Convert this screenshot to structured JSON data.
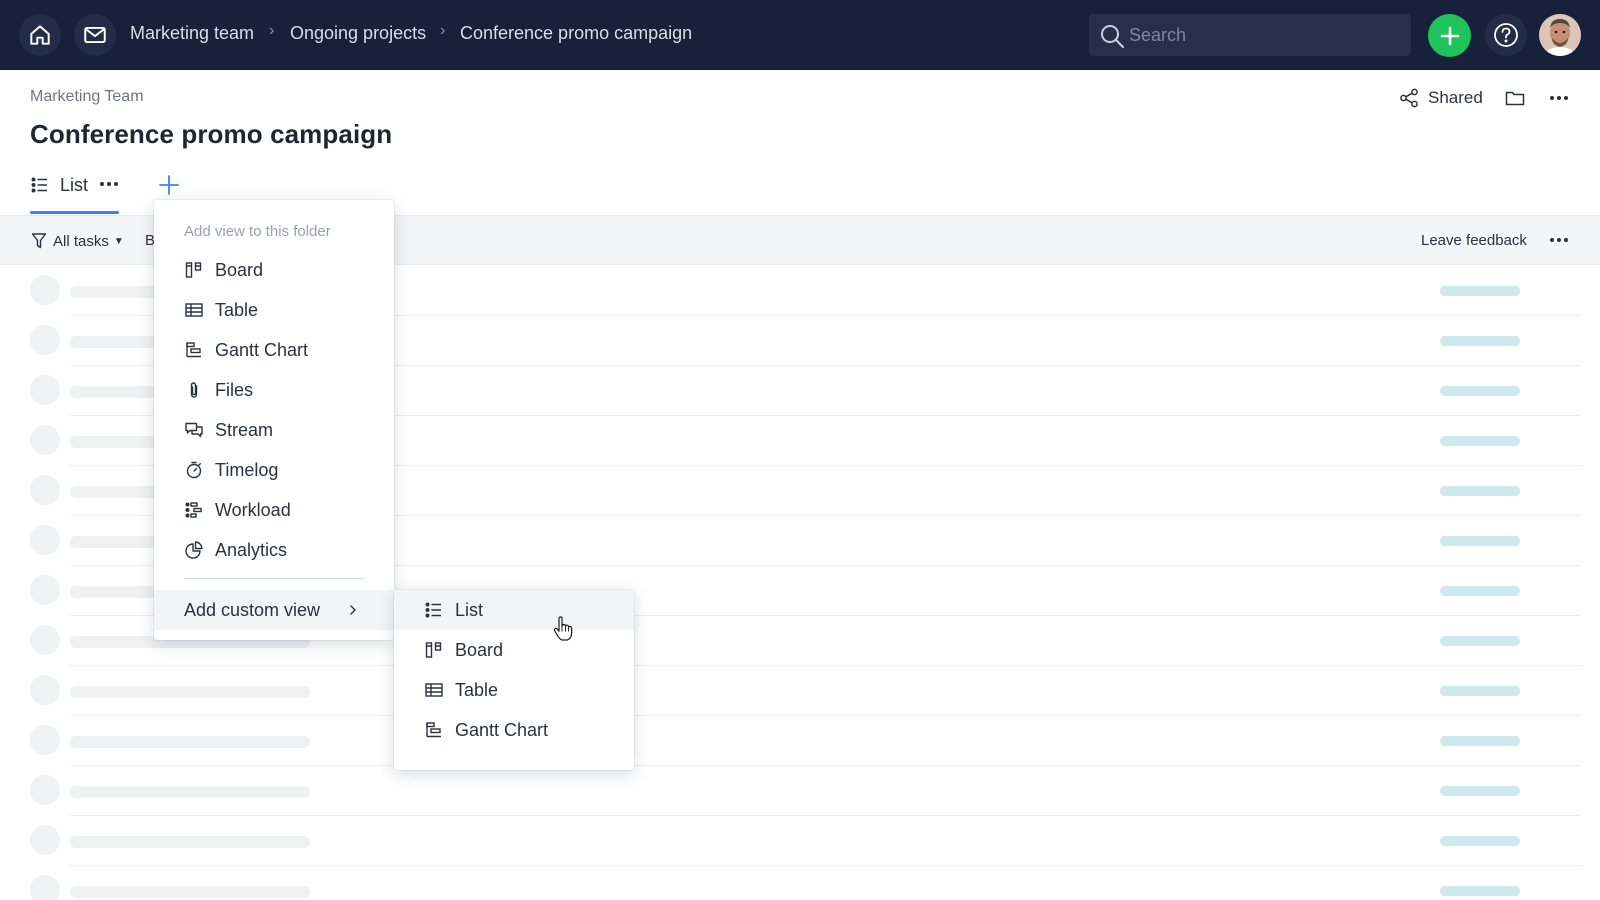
{
  "topbar": {
    "breadcrumbs": [
      "Marketing team",
      "Ongoing projects",
      "Conference promo campaign"
    ],
    "search_placeholder": "Search",
    "icons": [
      "home-icon",
      "mail-icon",
      "search-icon",
      "plus-icon",
      "help-icon",
      "avatar"
    ],
    "accent_color": "#1ec35c",
    "bar_color": "#17213a"
  },
  "header": {
    "folder_name": "Marketing Team",
    "title": "Conference promo campaign",
    "shared_label": "Shared"
  },
  "tabs": {
    "active_label": "List"
  },
  "toolbar": {
    "filter_label": "All tasks",
    "truncated_label": "B",
    "feedback_label": "Leave feedback"
  },
  "add_view_menu": {
    "header": "Add view to this folder",
    "items": [
      "Board",
      "Table",
      "Gantt Chart",
      "Files",
      "Stream",
      "Timelog",
      "Workload",
      "Analytics"
    ],
    "custom_label": "Add custom view"
  },
  "custom_view_submenu": {
    "items": [
      "List",
      "Board",
      "Table",
      "Gantt Chart"
    ],
    "hovered": "List"
  }
}
